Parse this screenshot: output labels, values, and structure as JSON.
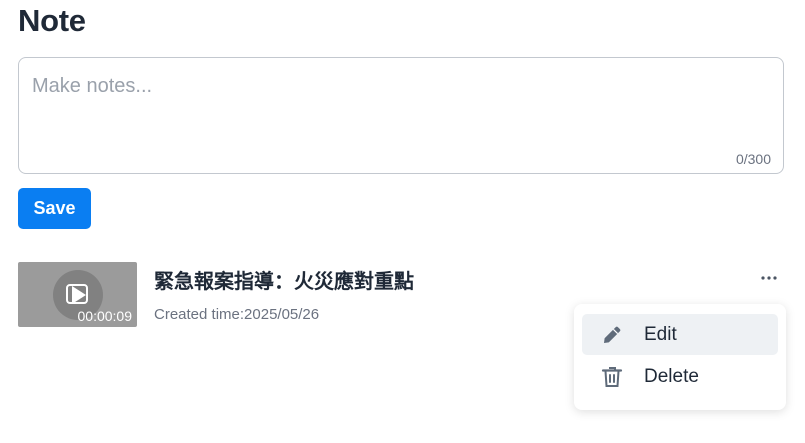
{
  "page": {
    "title": "Note"
  },
  "note_input": {
    "placeholder": "Make notes...",
    "value": "",
    "counter": "0/300"
  },
  "save_button": {
    "label": "Save"
  },
  "notes": [
    {
      "title": "緊急報案指導：火災應對重點",
      "created": "Created time:2025/05/26",
      "duration": "00:00:09",
      "thumbnail_icon": "play-icon"
    }
  ],
  "more_menu": {
    "trigger_icon": "more-horizontal-icon",
    "items": [
      {
        "label": "Edit",
        "icon": "pencil-icon",
        "highlighted": true
      },
      {
        "label": "Delete",
        "icon": "trash-icon",
        "highlighted": false
      }
    ]
  },
  "colors": {
    "primary": "#0a7ef2",
    "text": "#1f2937",
    "muted": "#6b7280",
    "border": "#c3c8cf",
    "menu_hover": "#eef1f4",
    "icon": "#5f6b7a"
  }
}
